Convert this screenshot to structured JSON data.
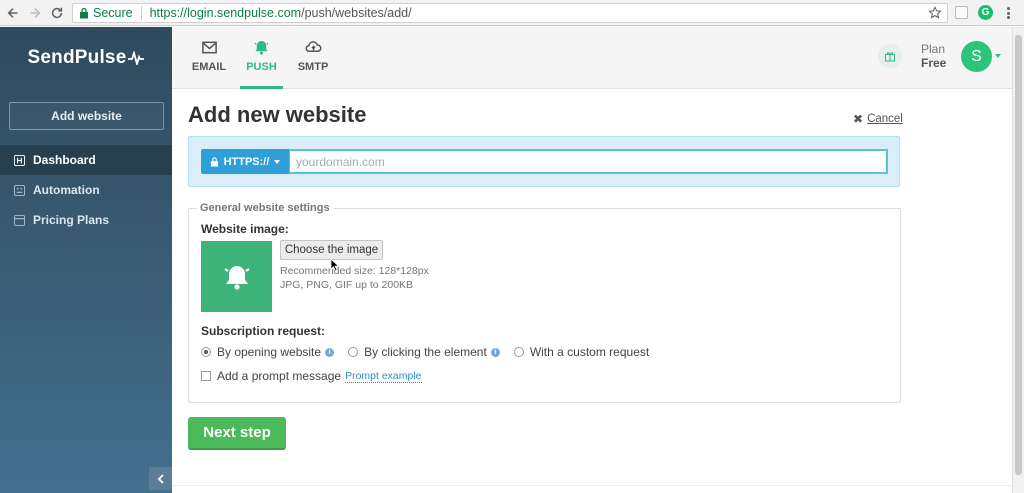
{
  "browser": {
    "secure_label": "Secure",
    "url_host": "https://login.sendpulse.com",
    "url_path": "/push/websites/add/",
    "extension_badge": "G"
  },
  "sidebar": {
    "logo": "SendPulse",
    "add_website_label": "Add website",
    "items": [
      {
        "label": "Dashboard",
        "icon": "dashboard-icon",
        "active": true
      },
      {
        "label": "Automation",
        "icon": "automation-icon",
        "active": false
      },
      {
        "label": "Pricing Plans",
        "icon": "pricing-icon",
        "active": false
      }
    ]
  },
  "header": {
    "tabs": [
      {
        "label": "EMAIL",
        "icon": "envelope-icon",
        "active": false
      },
      {
        "label": "PUSH",
        "icon": "bell-icon",
        "active": true
      },
      {
        "label": "SMTP",
        "icon": "cloud-upload-icon",
        "active": false
      }
    ],
    "plan_label": "Plan",
    "plan_value": "Free",
    "avatar_letter": "S"
  },
  "main": {
    "title": "Add new website",
    "cancel_label": "Cancel",
    "protocol_label": "HTTPS://",
    "domain_placeholder": "yourdomain.com",
    "settings_legend": "General website settings",
    "website_image_label": "Website image:",
    "choose_image_label": "Choose the image",
    "recommended_size": "Recommended size: 128*128px",
    "formats": "JPG, PNG, GIF up to 200KB",
    "subscription_label": "Subscription request:",
    "subscription_options": [
      {
        "label": "By opening website",
        "selected": true,
        "info": true
      },
      {
        "label": "By clicking the element",
        "selected": false,
        "info": true
      },
      {
        "label": "With a custom request",
        "selected": false,
        "info": false
      }
    ],
    "prompt_checkbox_label": "Add a prompt message",
    "prompt_example_link": "Prompt example",
    "next_step_label": "Next step"
  },
  "colors": {
    "accent_green": "#2fb88e",
    "button_green": "#4cb95a",
    "protocol_blue": "#2f9fd8",
    "sidebar_dark": "#2f4a5e"
  }
}
